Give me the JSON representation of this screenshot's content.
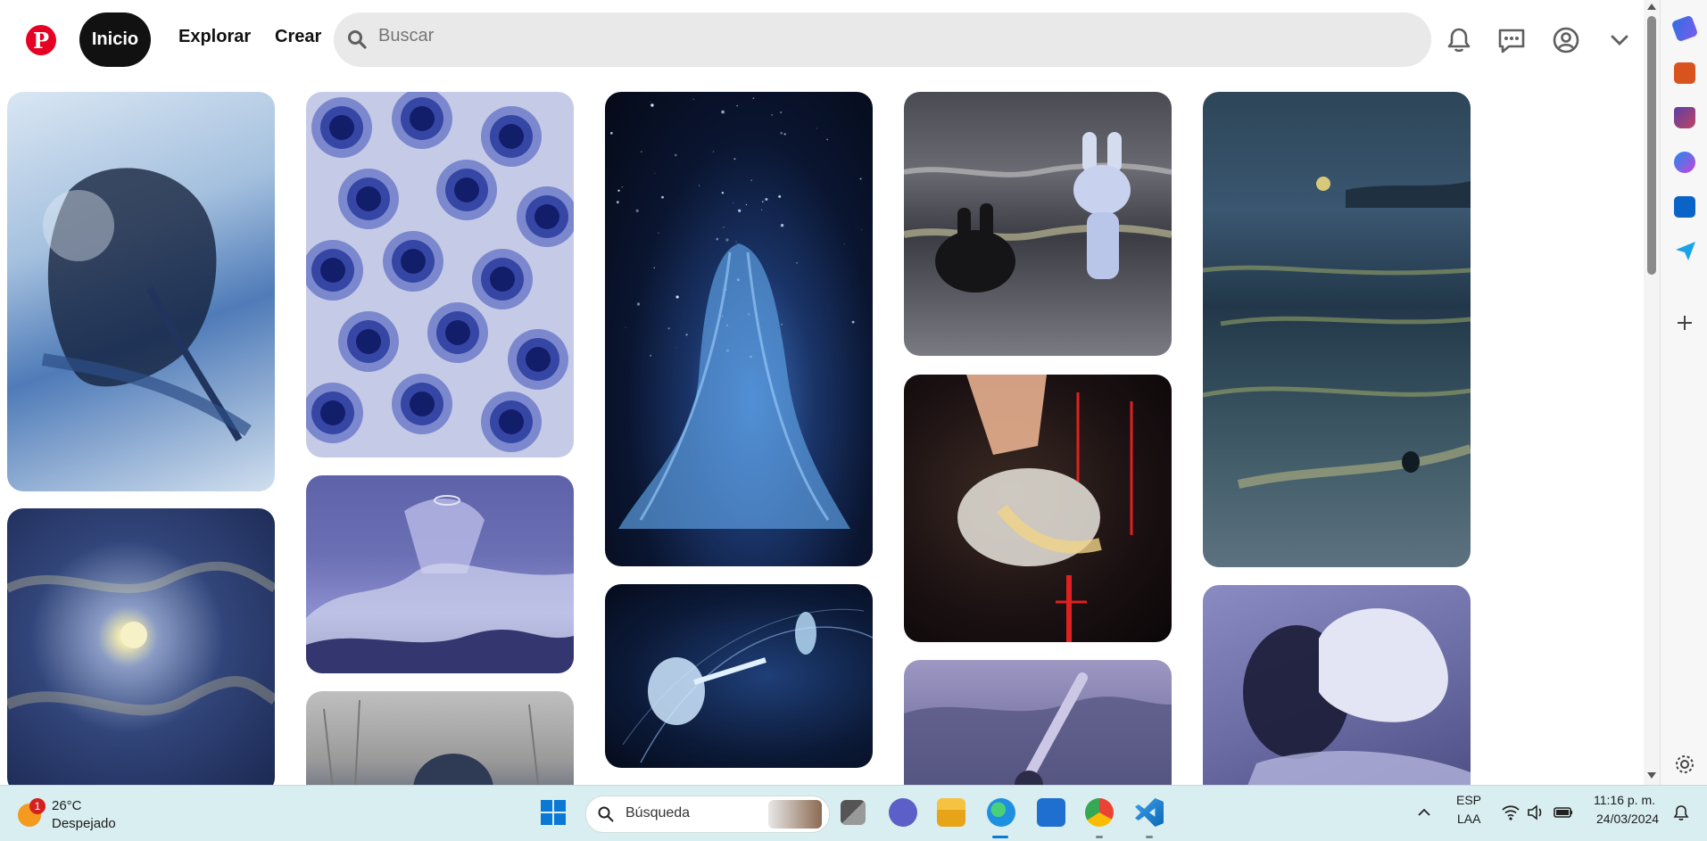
{
  "header": {
    "logo_icon": "pinterest-logo-icon",
    "home_label": "Inicio",
    "explore_label": "Explorar",
    "create_label": "Crear",
    "search_placeholder": "Buscar",
    "icons": [
      "bell-icon",
      "chat-icon",
      "account-icon",
      "chevron-down-icon"
    ]
  },
  "pins": [
    {
      "name": "pin-figure-watercolor",
      "colors": [
        "#a9c6e0",
        "#3f6fb0",
        "#0e1a33"
      ]
    },
    {
      "name": "pin-moon-clouds",
      "colors": [
        "#1d2c5a",
        "#6c80b3",
        "#d9cf8a"
      ]
    },
    {
      "name": "pin-eyes-pattern",
      "colors": [
        "#c7cde8",
        "#2d3f9c",
        "#101c6a"
      ]
    },
    {
      "name": "pin-angel-waves",
      "colors": [
        "#5b60a8",
        "#a7aad9",
        "#2f3272"
      ]
    },
    {
      "name": "pin-grey-figure",
      "colors": [
        "#b3b3b3",
        "#666",
        "#2c3850"
      ]
    },
    {
      "name": "pin-starry-girl",
      "colors": [
        "#06101f",
        "#1d3c74",
        "#69a7e6"
      ]
    },
    {
      "name": "pin-space-reach",
      "colors": [
        "#07122b",
        "#1a3668",
        "#a9d2ff"
      ]
    },
    {
      "name": "pin-bunnies-beach",
      "colors": [
        "#5a5a66",
        "#2b2b33",
        "#c4cce6"
      ]
    },
    {
      "name": "pin-hands-red-lights",
      "colors": [
        "#0e0a0c",
        "#3a1a14",
        "#f0c29a"
      ]
    },
    {
      "name": "pin-reaching-arm",
      "colors": [
        "#8b86b2",
        "#4b4b73",
        "#c5c0de"
      ]
    },
    {
      "name": "pin-night-sea",
      "colors": [
        "#3a5368",
        "#1d2f3d",
        "#a8b45f"
      ]
    },
    {
      "name": "pin-white-hair",
      "colors": [
        "#6e6fa6",
        "#d7d8ef",
        "#1a1b33"
      ]
    }
  ],
  "sidebar_icons": [
    "tag-icon",
    "briefcase-icon",
    "chess-icon",
    "copilot-icon",
    "outlook-icon",
    "send-icon",
    "add-icon",
    "settings-icon"
  ],
  "taskbar": {
    "weather": {
      "temp": "26°C",
      "condition": "Despejado",
      "badge": "1"
    },
    "search_placeholder": "Búsqueda",
    "lang_line1": "ESP",
    "lang_line2": "LAA",
    "time": "11:16 p. m.",
    "date": "24/03/2024",
    "apps": [
      "windows-start-icon",
      "task-view-icon",
      "meet-icon",
      "file-explorer-icon",
      "edge-icon",
      "store-icon",
      "chrome-icon",
      "vscode-icon"
    ]
  }
}
